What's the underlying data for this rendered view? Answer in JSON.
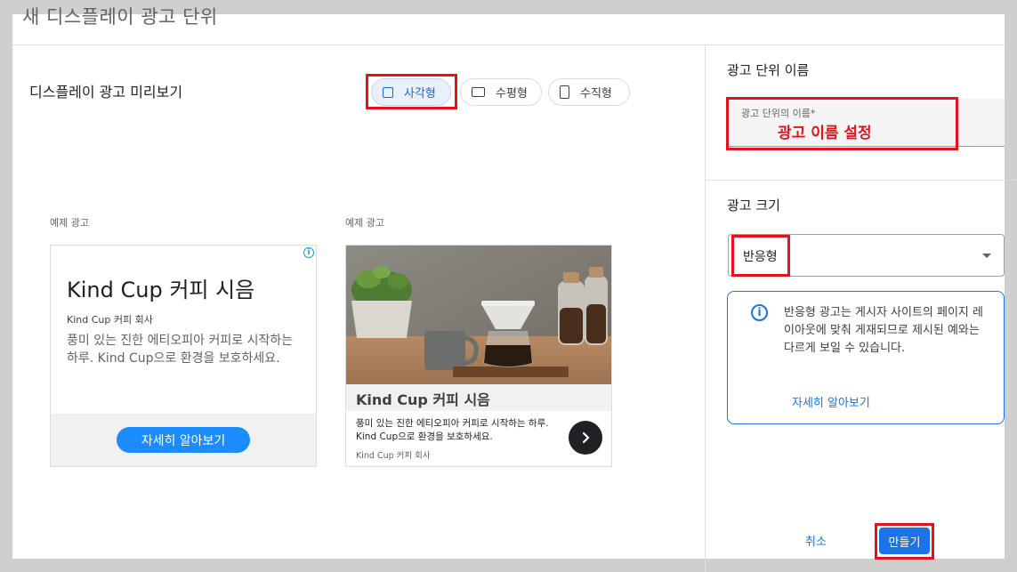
{
  "dialog": {
    "title": "새 디스플레이 광고 단위"
  },
  "preview": {
    "title": "디스플레이 광고 미리보기",
    "chips": [
      {
        "label": "사각형",
        "selected": true
      },
      {
        "label": "수평형",
        "selected": false
      },
      {
        "label": "수직형",
        "selected": false
      }
    ],
    "sample_label": "예제 광고"
  },
  "ad_square": {
    "headline": "Kind Cup 커피 시음",
    "company": "Kind Cup 커피 회사",
    "body": "풍미 있는 진한 에티오피아 커피로 시작하는 하루. Kind Cup으로 환경을 보호하세요.",
    "button": "자세히 알아보기",
    "badge": "i"
  },
  "ad_image": {
    "headline": "Kind Cup 커피 시음",
    "body": "풍미 있는 진한 에티오피아 커피로 시작하는 하루. Kind Cup으로 환경을 보호하세요.",
    "company": "Kind Cup 커피 회사"
  },
  "settings": {
    "name_section": "광고 단위 이름",
    "name_field_label": "광고 단위의 이름*",
    "name_field_value": "광고 이름 설정",
    "size_section": "광고 크기",
    "size_value": "반응형",
    "info_text": "반응형 광고는 게시자 사이트의 페이지 레이아웃에 맞춰 게재되므로 제시된 예와는 다르게 보일 수 있습니다.",
    "info_link": "자세히 알아보기"
  },
  "actions": {
    "cancel": "취소",
    "create": "만들기"
  },
  "colors": {
    "accent": "#1a73e8",
    "highlight": "#e3131b",
    "ad_button": "#1a8cff"
  }
}
